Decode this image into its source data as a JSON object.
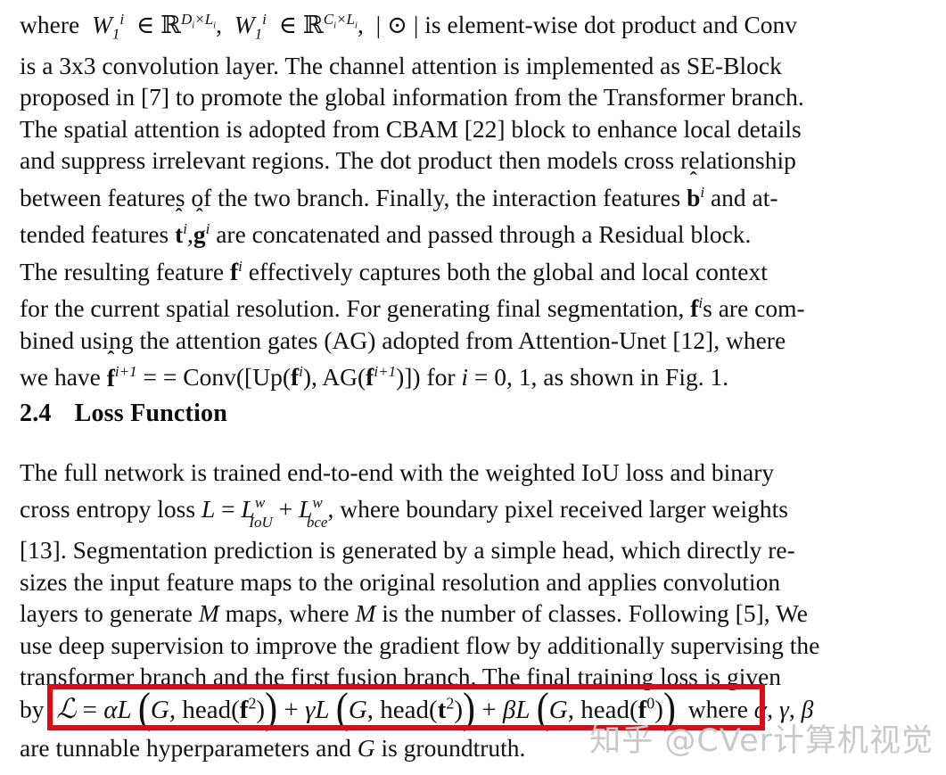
{
  "document": {
    "type": "academic-paper-page",
    "background_color": "#ffffff",
    "text_color": "#111111"
  },
  "paragraph_1": {
    "lines": [
      {
        "id": "l1",
        "segments": [
          "where ",
          "W",
          "1",
          "i",
          " ∈ ",
          "ℝ",
          "D",
          "i",
          "×",
          "L",
          "i",
          ", ",
          "W",
          "1",
          "i",
          " ∈ ",
          "ℝ",
          "C",
          "i",
          "×",
          "L",
          "i",
          ", | ⊙ | is element-wise dot product and Conv"
        ],
        "plain": "where W₁ⁱ ∈ ℝ^{Dᵢ×Lᵢ}, W₁ⁱ ∈ ℝ^{Cᵢ×Lᵢ}, | ⊙ | is element-wise dot product and Conv"
      },
      {
        "id": "l2",
        "plain": "is a 3x3 convolution layer. The channel attention is implemented as SE-Block"
      },
      {
        "id": "l3",
        "plain": "proposed in [7] to promote the global information from the Transformer branch."
      },
      {
        "id": "l4",
        "plain": "The spatial attention is adopted from CBAM [22] block to enhance local details"
      },
      {
        "id": "l5",
        "plain": "and suppress irrelevant regions. The dot product then models cross relationship"
      },
      {
        "id": "l6",
        "plain": "between features of the two branch. Finally, the interaction features b̂ⁱ and at-"
      },
      {
        "id": "l7",
        "plain": "tended features t̂ⁱ, ĝⁱ are concatenated and passed through a Residual block."
      },
      {
        "id": "l8",
        "plain": "The resulting feature fⁱ effectively captures both the global and local context"
      },
      {
        "id": "l9",
        "plain": "for the current spatial resolution. For generating final segmentation, fⁱs are com-"
      },
      {
        "id": "l10",
        "plain": "bined using the attention gates (AG) adopted from Attention-Unet [12], where"
      },
      {
        "id": "l11",
        "plain": "we have f̂ⁱ⁺¹ = Conv([Up(fⁱ), AG(fⁱ⁺¹)]) for i = 0, 1, as shown in Fig. 1."
      }
    ],
    "word_l1_a": "where",
    "word_l1_end": "| ⊙ | is element-wise dot product and Conv",
    "line2": "is a 3x3 convolution layer. The channel attention is implemented as SE-Block",
    "line3": "proposed in [7] to promote the global information from the Transformer branch.",
    "line4": "The spatial attention is adopted from CBAM [22] block to enhance local details",
    "line5": "and suppress irrelevant regions. The dot product then models cross relationship",
    "line6_a": "between features of the two branch. Finally, the interaction features",
    "line6_b": "and at-",
    "line7_a": "tended features",
    "line7_b": "are concatenated and passed through a Residual block.",
    "line8_a": "The resulting feature",
    "line8_b": "effectively captures both the global and local context",
    "line9_a": "for the current spatial resolution. For generating final segmentation,",
    "line9_b": "s are com-",
    "line10": "bined using the attention gates (AG) adopted from Attention-Unet [12], where",
    "line11_a": "we have",
    "line11_b": "= Conv([Up(",
    "line11_c": "), AG(",
    "line11_d": ")]) for",
    "line11_e": "= 0, 1, as shown in Fig. 1."
  },
  "heading": {
    "number": "2.4",
    "title": "Loss Function"
  },
  "paragraph_2": {
    "line1": "The full network is trained end-to-end with the weighted IoU loss and binary",
    "line2_a": "cross entropy loss",
    "line2_b": ", where boundary pixel received larger weights",
    "line3": "[13]. Segmentation prediction is generated by a simple head, which directly re-",
    "line4": "sizes the input feature maps to the original resolution and applies convolution",
    "line5_a": "layers to generate",
    "line5_b": "maps, where",
    "line5_c": "is the number of classes. Following [5], We",
    "line6": "use deep supervision to improve the gradient flow by additionally supervising the",
    "line7": "transformer branch and the first fusion branch. The final training loss is given",
    "line8_prefix": "by",
    "line8_suffix": "where α, γ, β",
    "line9": "are tunnable hyperparameters and G is groundtruth."
  },
  "equation": {
    "plain": "ℒ = αL (G, head(f̂²)) + γL (G, head(t²)) + βL (G, head(f⁰))",
    "script_L": "ℒ",
    "equals": "=",
    "alpha": "α",
    "gamma": "γ",
    "beta": "β",
    "L": "L",
    "G": "G",
    "head": "head",
    "comma": ",",
    "plus": "+",
    "arg1_base": "f",
    "arg1_exp": "2",
    "arg2_base": "t",
    "arg2_exp": "2",
    "arg3_base": "f",
    "arg3_exp": "0",
    "highlight_color": "#dd0b17"
  },
  "watermark": {
    "text": "知乎 @CVer计算机视觉",
    "color": "#c9c9c9"
  }
}
